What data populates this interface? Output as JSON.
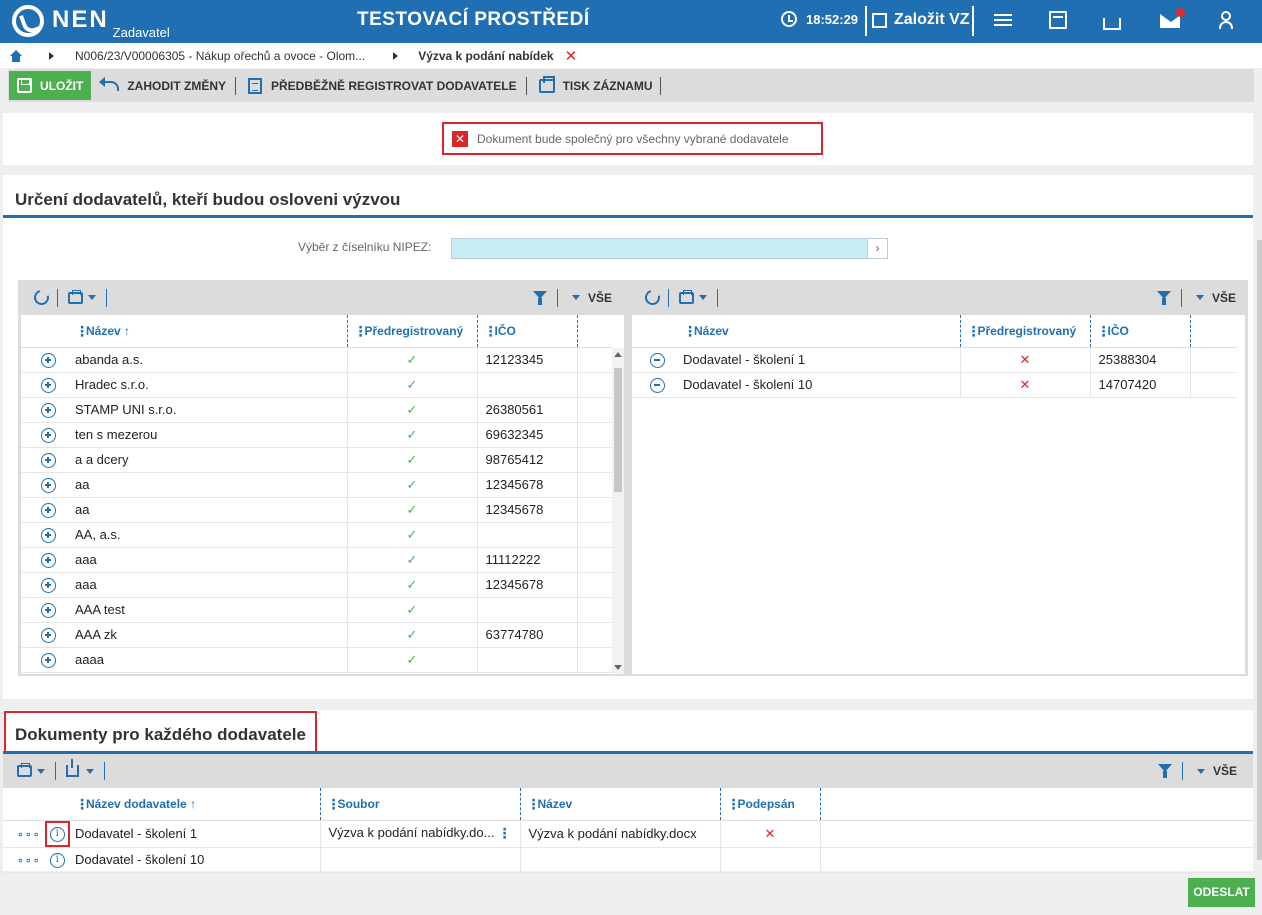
{
  "header": {
    "logo_text": "NEN",
    "logo_sub": "Zadavatel",
    "environment": "TESTOVACÍ PROSTŘEDÍ",
    "time": "18:52:29",
    "create_label": "Založit VZ",
    "icons": [
      "menu-icon",
      "calculator-icon",
      "inbox-icon",
      "mail-icon",
      "user-icon"
    ]
  },
  "breadcrumb": {
    "item1": "N006/23/V00006305 - Nákup ořechů a ovoce - Olom...",
    "item2": "Výzva k podání nabídek",
    "close": "✕"
  },
  "toolbar": {
    "save": "ULOŽIT",
    "discard": "ZAHODIT ZMĚNY",
    "preregister": "PŘEDBĚŽNĚ REGISTROVAT DODAVATELE",
    "print": "TISK ZÁZNAMU"
  },
  "notice": {
    "icon": "✕",
    "text": "Dokument bude společný pro všechny vybrané dodavatele"
  },
  "suppliers_section": {
    "title": "Určení dodavatelů, kteří budou osloveni výzvou",
    "nipez_label": "Výběr z číselníku NIPEZ:",
    "nipez_value": "",
    "nipez_btn": "›",
    "left_grid": {
      "filter_all": "VŠE",
      "columns": [
        "Název",
        "Předregistrovaný",
        "IČO"
      ],
      "sort_arrow": "↑",
      "rows": [
        {
          "name": "abanda a.s.",
          "prereg": "✓",
          "ico": "12123345"
        },
        {
          "name": "Hradec s.r.o.",
          "prereg": "✓",
          "ico": ""
        },
        {
          "name": "STAMP UNI s.r.o.",
          "prereg": "✓",
          "ico": "26380561"
        },
        {
          "name": "ten s mezerou",
          "prereg": "✓",
          "ico": "69632345"
        },
        {
          "name": "a a dcery",
          "prereg": "✓",
          "ico": "98765412"
        },
        {
          "name": "aa",
          "prereg": "✓",
          "ico": "12345678"
        },
        {
          "name": "aa",
          "prereg": "✓",
          "ico": "12345678"
        },
        {
          "name": "AA, a.s.",
          "prereg": "✓",
          "ico": ""
        },
        {
          "name": "aaa",
          "prereg": "✓",
          "ico": "11112222"
        },
        {
          "name": "aaa",
          "prereg": "✓",
          "ico": "12345678"
        },
        {
          "name": "AAA test",
          "prereg": "✓",
          "ico": ""
        },
        {
          "name": "AAA zk",
          "prereg": "✓",
          "ico": "63774780"
        },
        {
          "name": "aaaa",
          "prereg": "✓",
          "ico": ""
        }
      ]
    },
    "right_grid": {
      "filter_all": "VŠE",
      "columns": [
        "Název",
        "Předregistrovaný",
        "IČO"
      ],
      "rows": [
        {
          "name": "Dodavatel - školení 1",
          "prereg": "✕",
          "ico": "25388304"
        },
        {
          "name": "Dodavatel - školení 10",
          "prereg": "✕",
          "ico": "14707420"
        }
      ]
    }
  },
  "documents_section": {
    "title": "Dokumenty pro každého dodavatele",
    "filter_all": "VŠE",
    "columns": [
      "Název dodavatele",
      "Soubor",
      "Název",
      "Podepsán"
    ],
    "sort_arrow": "↑",
    "rows": [
      {
        "supplier": "Dodavatel - školení 1",
        "file": "Výzva k podání nabídky.do...",
        "name": "Výzva k podání nabídky.docx",
        "signed": "✕"
      },
      {
        "supplier": "Dodavatel - školení 10",
        "file": "",
        "name": "",
        "signed": ""
      }
    ]
  },
  "footer": {
    "send": "ODESLAT"
  }
}
